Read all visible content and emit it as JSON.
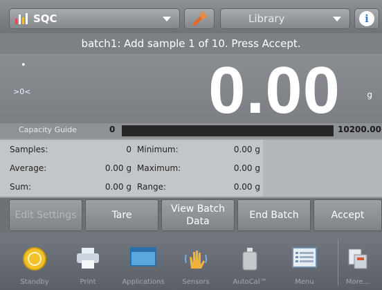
{
  "header": {
    "app_selector": "SQC",
    "library_selector": "Library"
  },
  "instruction": "batch1: Add sample 1 of 10.  Press Accept.",
  "display": {
    "stable_dot": "•",
    "zero_indicator": ">0<",
    "weight": "0.00",
    "unit": "g"
  },
  "capacity_guide": {
    "label": "Capacity Guide",
    "min": "0",
    "max": "10200.00",
    "fill_fraction": 0
  },
  "stats": {
    "left": [
      {
        "label": "Samples:",
        "value": "0"
      },
      {
        "label": "Average:",
        "value": "0.00 g"
      },
      {
        "label": "Sum:",
        "value": "0.00 g"
      }
    ],
    "right": [
      {
        "label": "Minimum:",
        "value": "0.00 g"
      },
      {
        "label": "Maximum:",
        "value": "0.00 g"
      },
      {
        "label": "Range:",
        "value": "0.00 g"
      }
    ]
  },
  "actions": {
    "edit_settings": "Edit Settings",
    "tare": "Tare",
    "view_batch_data_1": "View Batch",
    "view_batch_data_2": "Data",
    "end_batch": "End Batch",
    "accept": "Accept"
  },
  "nav": {
    "standby": "Standby",
    "print": "Print",
    "applications": "Applications",
    "sensors": "Sensors",
    "autocal": "AutoCal™",
    "menu": "Menu",
    "more": "More..."
  },
  "colors": {
    "accent_blue": "#3d7cc0",
    "standby_yellow": "#f3c22a"
  }
}
